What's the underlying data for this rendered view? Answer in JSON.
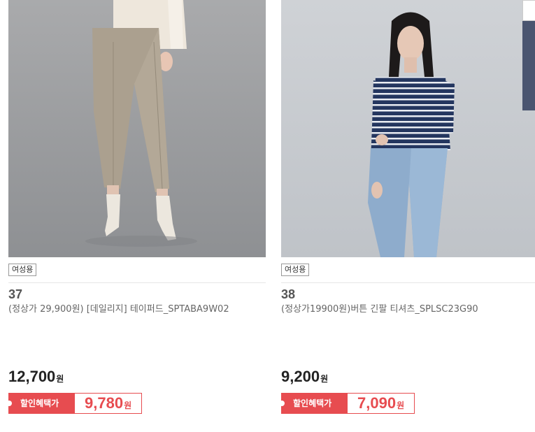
{
  "products": [
    {
      "tag": "여성용",
      "number": "37",
      "name": "(정상가 29,900원) [데일리지] 테이퍼드_SPTABA9W02",
      "price": "12,700",
      "price_unit": "원",
      "benefit_label": "할인혜택가",
      "benefit_price": "9,780",
      "benefit_unit": "원",
      "image": "model in beige tapered trousers and white ankle boots"
    },
    {
      "tag": "여성용",
      "number": "38",
      "name": "(정상가19900원)버튼 긴팔 티셔츠_SPLSC23G90",
      "price": "9,200",
      "price_unit": "원",
      "benefit_label": "할인혜택가",
      "benefit_price": "7,090",
      "benefit_unit": "원",
      "image": "model in navy striped long sleeve t-shirt and jeans"
    }
  ],
  "colors": {
    "accent": "#e74c50",
    "side_panel": "#4a5570"
  }
}
